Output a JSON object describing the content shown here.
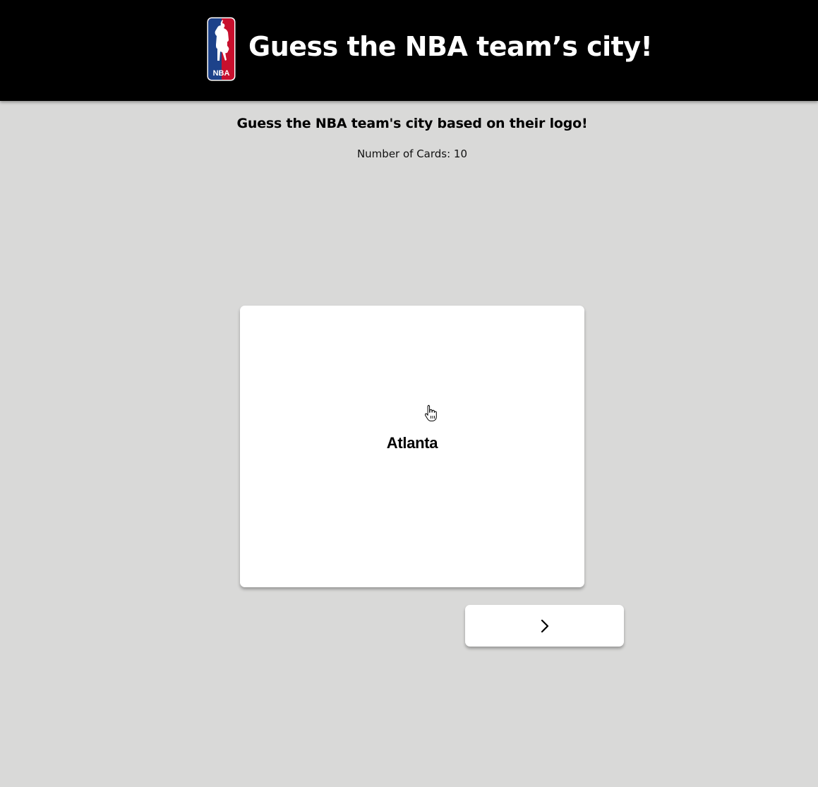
{
  "header": {
    "title": "Guess the NBA team’s city!",
    "logo_icon": "nba-logo",
    "logo_text": "NBA",
    "logo_colors": {
      "red": "#c8102e",
      "blue": "#1d428a"
    }
  },
  "main": {
    "subtitle": "Guess the NBA team's city based on their logo!",
    "card_count": "Number of Cards: 10"
  },
  "card": {
    "text": "Atlanta"
  },
  "controls": {
    "next_icon": "chevron-right-icon"
  },
  "colors": {
    "page_background": "#d9d9d8",
    "header_background": "#000000",
    "card_background": "#ffffff"
  }
}
